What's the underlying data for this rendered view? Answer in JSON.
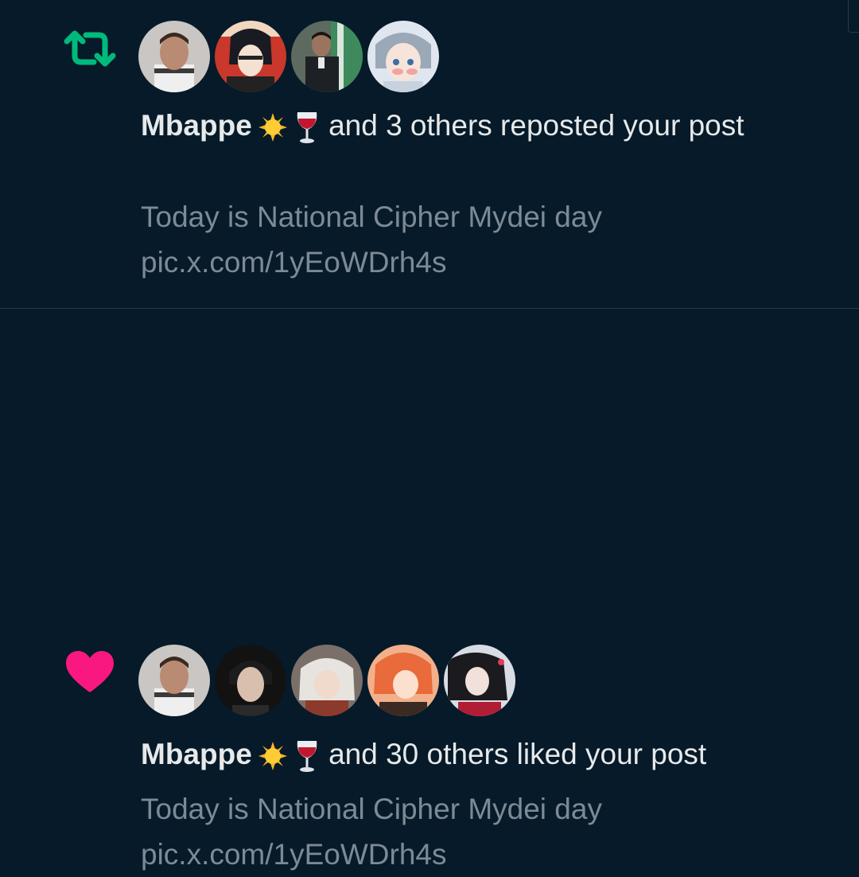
{
  "notifications": [
    {
      "type": "repost",
      "icon": "repost-icon",
      "icon_color": "#00ba7c",
      "user": "Mbappe",
      "emojis": [
        "sun-emoji",
        "wine-glass-emoji"
      ],
      "action_text": "and 3 others reposted your post",
      "snippet_line1": "Today is National Cipher Mydei day",
      "snippet_line2": "pic.x.com/1yEoWDrh4s",
      "avatar_count": 4
    },
    {
      "type": "like",
      "icon": "heart-icon",
      "icon_color": "#f91880",
      "user": "Mbappe",
      "emojis": [
        "sun-emoji",
        "wine-glass-emoji"
      ],
      "action_text": "and 30 others liked your post",
      "snippet_line1": "Today is National Cipher Mydei day",
      "snippet_line2": "pic.x.com/1yEoWDrh4s",
      "avatar_count": 5
    }
  ],
  "colors": {
    "background": "#061a29",
    "text_primary": "#e7e9ea",
    "text_secondary": "#7d8a95",
    "divider": "#2a3a47"
  }
}
